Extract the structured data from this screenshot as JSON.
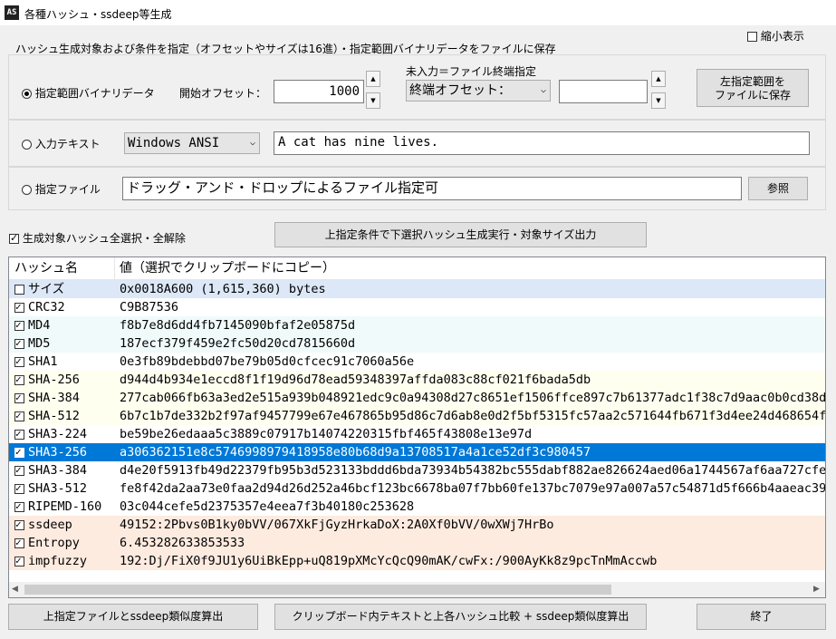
{
  "window": {
    "title": "各種ハッシュ・ssdeep等生成",
    "icon": "app-icon"
  },
  "compact": {
    "label": "縮小表示",
    "checked": false
  },
  "target_group": {
    "title": "ハッシュ生成対象および条件を指定（オフセットやサイズは16進）・指定範囲バイナリデータをファイルに保存"
  },
  "binary": {
    "radio_label": "指定範囲バイナリデータ",
    "offset_label": "開始オフセット：",
    "offset_value": "1000",
    "hint": "未入力＝ファイル終端指定",
    "end_select": "終端オフセット：",
    "end_value": "",
    "save_button": "左指定範囲を\nファイルに保存"
  },
  "text": {
    "radio_label": "入力テキスト",
    "encoding": "Windows ANSI",
    "value": "A cat has nine lives."
  },
  "file": {
    "radio_label": "指定ファイル",
    "placeholder": "ドラッグ・アンド・ドロップによるファイル指定可",
    "browse_button": "参照"
  },
  "select_all": {
    "label": "生成対象ハッシュ全選択・全解除",
    "checked": true
  },
  "run_button": "上指定条件で下選択ハッシュ生成実行・対象サイズ出力",
  "list": {
    "headers": [
      "ハッシュ名",
      "値（選択でクリップボードにコピー）"
    ],
    "rows": [
      {
        "name": "サイズ",
        "value": "0x0018A600 (1,615,360) bytes",
        "checked": false,
        "bg": "#dce8f7"
      },
      {
        "name": "CRC32",
        "value": "C9B87536",
        "checked": true,
        "bg": "#ffffff"
      },
      {
        "name": "MD4",
        "value": "f8b7e8d6dd4fb7145090bfaf2e05875d",
        "checked": true,
        "bg": "#f0fafa"
      },
      {
        "name": "MD5",
        "value": "187ecf379f459e2fc50d20cd7815660d",
        "checked": true,
        "bg": "#f0fafa"
      },
      {
        "name": "SHA1",
        "value": "0e3fb89bdebbd07be79b05d0cfcec91c7060a56e",
        "checked": true,
        "bg": "#ffffff"
      },
      {
        "name": "SHA-256",
        "value": "d944d4b934e1eccd8f1f19d96d78ead59348397affda083c88cf021f6bada5db",
        "checked": true,
        "bg": "#fffff0"
      },
      {
        "name": "SHA-384",
        "value": "277cab066fb63a3ed2e515a939b048921edc9c0a94308d27c8651ef1506ffce897c7b61377adc1f38c7d9aac0b0cd38d",
        "checked": true,
        "bg": "#fffff0"
      },
      {
        "name": "SHA-512",
        "value": "6b7c1b7de332b2f97af9457799e67e467865b95d86c7d6ab8e0d2f5bf5315fc57aa2c571644fb671f3d4ee24d468654f2",
        "checked": true,
        "bg": "#fffff0"
      },
      {
        "name": "SHA3-224",
        "value": "be59be26edaaa5c3889c07917b14074220315fbf465f43808e13e97d",
        "checked": true,
        "bg": "#ffffff"
      },
      {
        "name": "SHA3-256",
        "value": "a306362151e8c5746998979418958e80b68d9a13708517a4a1ce52df3c980457",
        "checked": true,
        "bg": "#0078d7",
        "selected": true
      },
      {
        "name": "SHA3-384",
        "value": "d4e20f5913fb49d22379fb95b3d523133bddd6bda73934b54382bc555dabf882ae826624aed06a1744567af6aa727cfe",
        "checked": true,
        "bg": "#ffffff"
      },
      {
        "name": "SHA3-512",
        "value": "fe8f42da2aa73e0faa2d94d26d252a46bcf123bc6678ba07f7bb60fe137bc7079e97a007a57c54871d5f666b4aaeac390",
        "checked": true,
        "bg": "#ffffff"
      },
      {
        "name": "RIPEMD-160",
        "value": "03c044cefe5d2375357e4eea7f3b40180c253628",
        "checked": true,
        "bg": "#ffffff"
      },
      {
        "name": "ssdeep",
        "value": "49152:2Pbvs0B1ky0bVV/067XkFjGyzHrkaDoX:2A0Xf0bVV/0wXWj7HrBo",
        "checked": true,
        "bg": "#fdebe0"
      },
      {
        "name": "Entropy",
        "value": "6.453282633853533",
        "checked": true,
        "bg": "#fdebe0"
      },
      {
        "name": "impfuzzy",
        "value": "192:Dj/FiX0f9JU1y6UiBkEpp+uQ819pXMcYcQcQ90mAK/cwFx:/900AyKk8z9pcTnMmAccwb",
        "checked": true,
        "bg": "#fdebe0"
      }
    ]
  },
  "bottom": {
    "ssdeep_file": "上指定ファイルとssdeep類似度算出",
    "clipboard_compare": "クリップボード内テキストと上各ハッシュ比較 + ssdeep類似度算出",
    "exit": "終了"
  }
}
